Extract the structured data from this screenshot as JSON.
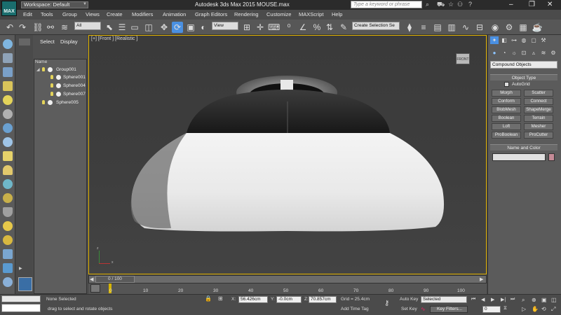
{
  "app": {
    "logo": "MAX",
    "title": "Autodesk 3ds Max  2015      MOUSE.max",
    "workspace": "Workspace: Default",
    "search_placeholder": "Type a keyword or phrase"
  },
  "menu": [
    "Edit",
    "Tools",
    "Group",
    "Views",
    "Create",
    "Modifiers",
    "Animation",
    "Graph Editors",
    "Rendering",
    "Customize",
    "MAXScript",
    "Help"
  ],
  "toolbar": {
    "filter_select": "All",
    "view_select": "View",
    "selection_set": "Create Selection Se"
  },
  "scene_explorer": {
    "tabs": [
      "Select",
      "Display"
    ],
    "column": "Name",
    "items": [
      {
        "name": "Group001",
        "level": 0
      },
      {
        "name": "Sphere001",
        "level": 1
      },
      {
        "name": "Sphere004",
        "level": 1
      },
      {
        "name": "Sphere007",
        "level": 1
      },
      {
        "name": "Sphere005",
        "level": 0
      }
    ]
  },
  "viewport": {
    "label": "[+] [Front ] [Realistic ]",
    "viewcube": "FRONT",
    "axes": [
      "x",
      "z"
    ]
  },
  "command_panel": {
    "category": "Compound Objects",
    "object_type_title": "Object Type",
    "autogrid": "AutoGrid",
    "buttons": [
      "Morph",
      "Scatter",
      "Conform",
      "Connect",
      "BlobMesh",
      "ShapeMerge",
      "Boolean",
      "Terrain",
      "Loft",
      "Mesher",
      "ProBoolean",
      "ProCutter"
    ],
    "name_color_title": "Name and Color"
  },
  "timeline": {
    "slider": "0 / 100",
    "ticks": [
      "0",
      "10",
      "20",
      "30",
      "40",
      "50",
      "60",
      "70",
      "80",
      "90",
      "100"
    ]
  },
  "status": {
    "selection": "None Selected",
    "prompt": "drag to select and rotate objects",
    "x_label": "X:",
    "x": "56.426cm",
    "y_label": "Y:",
    "y": "-0.0cm",
    "z_label": "Z:",
    "z": "70.857cm",
    "grid": "Grid = 25.4cm",
    "add_time_tag": "Add Time Tag",
    "auto_key": "Auto Key",
    "auto_key_value": "Selected",
    "set_key": "Set Key",
    "key_filters": "Key Filters...",
    "frame": "0"
  },
  "colors": {
    "viewport_border": "#e3b400",
    "logo_bg": "#1a6d6d",
    "name_swatch": "#c48a96"
  }
}
